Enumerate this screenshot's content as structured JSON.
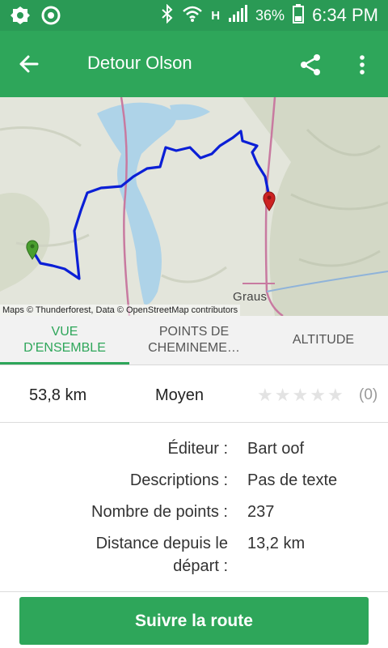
{
  "status_bar": {
    "time": "6:34 PM",
    "battery": "36%",
    "network": "H",
    "icons": [
      "settings-icon",
      "sync-icon",
      "bluetooth-icon",
      "wifi-icon",
      "signal-icon",
      "battery-icon"
    ]
  },
  "app_bar": {
    "title": "Detour Olson",
    "icons": [
      "back-arrow-icon",
      "share-icon",
      "more-vert-icon"
    ]
  },
  "map": {
    "attribution": "Maps © Thunderforest, Data © OpenStreetMap contributors",
    "town_label": "Graus",
    "colors": {
      "route": "#0b1fd6",
      "start_marker": "#4a9e2f",
      "end_marker": "#cc2222",
      "water": "#aed3e8"
    }
  },
  "tabs": [
    {
      "label_line1": "VUE",
      "label_line2": "D'ENSEMBLE",
      "active": true
    },
    {
      "label_line1": "POINTS DE",
      "label_line2": "CHEMINEME…",
      "active": false
    },
    {
      "label_line1": "ALTITUDE",
      "label_line2": "",
      "active": false
    }
  ],
  "summary": {
    "distance": "53,8 km",
    "difficulty": "Moyen",
    "rating_stars": 0,
    "rating_max": 5,
    "rating_count": "(0)"
  },
  "details": [
    {
      "label": "Éditeur :",
      "value": "Bart oof"
    },
    {
      "label": "Descriptions :",
      "value": "Pas de texte"
    },
    {
      "label": "Nombre de points :",
      "value": "237"
    },
    {
      "label": "Distance depuis le départ :",
      "value": "13,2 km"
    }
  ],
  "actions": {
    "follow_route": "Suivre la route"
  },
  "colors": {
    "primary": "#2ea65a",
    "status_bar": "#2a9a55"
  }
}
